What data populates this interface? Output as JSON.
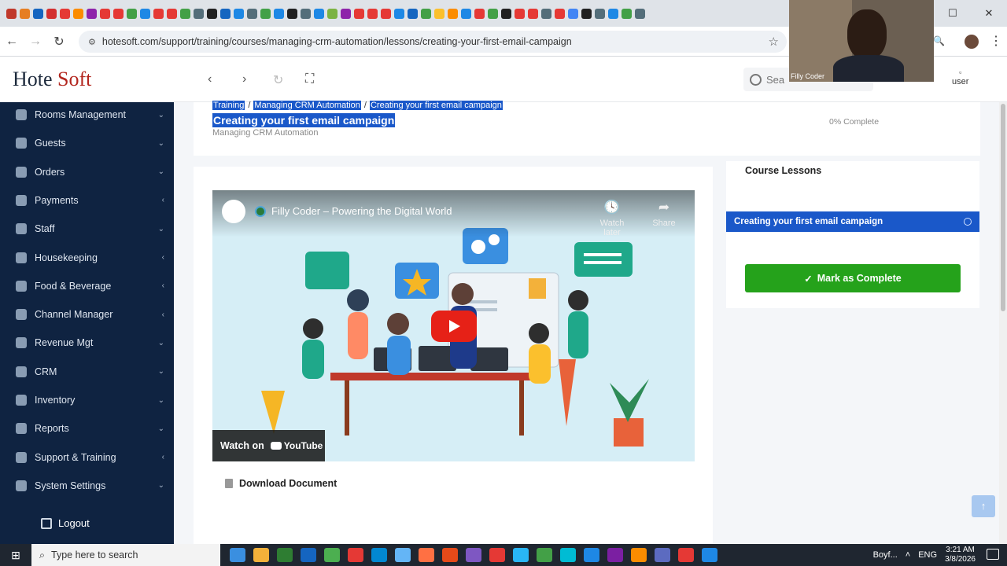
{
  "browser": {
    "url": "hotesoft.com/support/training/courses/managing-crm-automation/lessons/creating-your-first-email-campaign",
    "window_controls": {
      "minimize": "—",
      "maximize": "☐",
      "close": "✕"
    },
    "favicon_colors": [
      "#c0392b",
      "#e67e22",
      "#1565c0",
      "#d32f2f",
      "#e53935",
      "#fb8c00",
      "#8e24aa",
      "#e53935",
      "#e53935",
      "#43a047",
      "#1e88e5",
      "#e53935",
      "#e53935",
      "#43a047",
      "#546e7a",
      "#212121",
      "#1565c0",
      "#1e88e5",
      "#546e7a",
      "#43a047",
      "#1e88e5",
      "#212121",
      "#546e7a",
      "#1e88e5",
      "#7cb342",
      "#8e24aa",
      "#e53935",
      "#e53935",
      "#e53935",
      "#1e88e5",
      "#1565c0",
      "#43a047",
      "#fbc02d",
      "#fb8c00",
      "#1e88e5",
      "#e53935",
      "#43a047",
      "#212121",
      "#e53935",
      "#e53935",
      "#546e7a",
      "#e53935",
      "#4285f4",
      "#212121",
      "#546e7a",
      "#1e88e5",
      "#43a047",
      "#546e7a"
    ]
  },
  "header": {
    "logo_part1": "Hote",
    "logo_part2": "Soft",
    "search_placeholder": "Sea",
    "user_label": "user"
  },
  "sidebar": {
    "items": [
      {
        "label": "Rooms Management",
        "chevron": "⌄"
      },
      {
        "label": "Guests",
        "chevron": "⌄"
      },
      {
        "label": "Orders",
        "chevron": "⌄"
      },
      {
        "label": "Payments",
        "chevron": "‹"
      },
      {
        "label": "Staff",
        "chevron": "⌄"
      },
      {
        "label": "Housekeeping",
        "chevron": "‹"
      },
      {
        "label": "Food & Beverage",
        "chevron": "‹"
      },
      {
        "label": "Channel Manager",
        "chevron": "‹"
      },
      {
        "label": "Revenue Mgt",
        "chevron": "⌄"
      },
      {
        "label": "CRM",
        "chevron": "⌄"
      },
      {
        "label": "Inventory",
        "chevron": "⌄"
      },
      {
        "label": "Reports",
        "chevron": "⌄"
      },
      {
        "label": "Support & Training",
        "chevron": "‹"
      },
      {
        "label": "System Settings",
        "chevron": "⌄"
      }
    ],
    "logout": "Logout"
  },
  "lesson": {
    "breadcrumb": [
      "Training",
      "Managing CRM Automation",
      "Creating your first email campaign"
    ],
    "breadcrumb_sep": "/",
    "title": "Creating your first email campaign",
    "course": "Managing CRM Automation",
    "progress": "0% Complete",
    "progress_fraction": 0,
    "download": "Download Document"
  },
  "video": {
    "title": "Filly Coder – Powering the Digital World",
    "watch_later": "Watch later",
    "share": "Share",
    "watch_on": "Watch on",
    "youtube": "YouTube"
  },
  "course_lessons": {
    "heading": "Course Lessons",
    "items": [
      {
        "label": "Creating your first email campaign"
      }
    ],
    "complete_button": "Mark as Complete"
  },
  "webcam": {
    "name": "Filly Coder"
  },
  "taskbar": {
    "search_placeholder": "Type here to search",
    "app_label": "Boyf...",
    "lang": "ENG",
    "time": "3:21 AM",
    "date": "3/8/2026"
  }
}
